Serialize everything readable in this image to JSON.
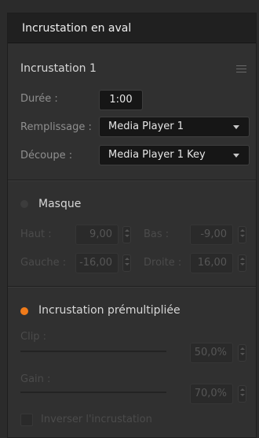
{
  "panel": {
    "title": "Incrustation en aval",
    "section_title": "Incrustation 1",
    "duration": {
      "label": "Durée :",
      "value": "1:00"
    },
    "fill": {
      "label": "Remplissage :",
      "value": "Media Player 1"
    },
    "key": {
      "label": "Découpe :",
      "value": "Media Player 1 Key"
    }
  },
  "mask": {
    "label": "Masque",
    "enabled": false,
    "top": {
      "label": "Haut :",
      "value": "9,00"
    },
    "bottom": {
      "label": "Bas :",
      "value": "-9,00"
    },
    "left": {
      "label": "Gauche :",
      "value": "-16,00"
    },
    "right": {
      "label": "Droite :",
      "value": "16,00"
    }
  },
  "premult": {
    "label": "Incrustation prémultipliée",
    "enabled": true,
    "clip": {
      "label": "Clip :",
      "value": "50,0%"
    },
    "gain": {
      "label": "Gain :",
      "value": "70,0%"
    },
    "invert_label": "Inverser l'incrustation"
  },
  "colors": {
    "accent": "#f07b1a",
    "mask_dot": "#3c3c3c",
    "panel_bg": "#303030",
    "header_bg": "#202020"
  },
  "icons": {
    "menu": "hamburger-icon"
  }
}
